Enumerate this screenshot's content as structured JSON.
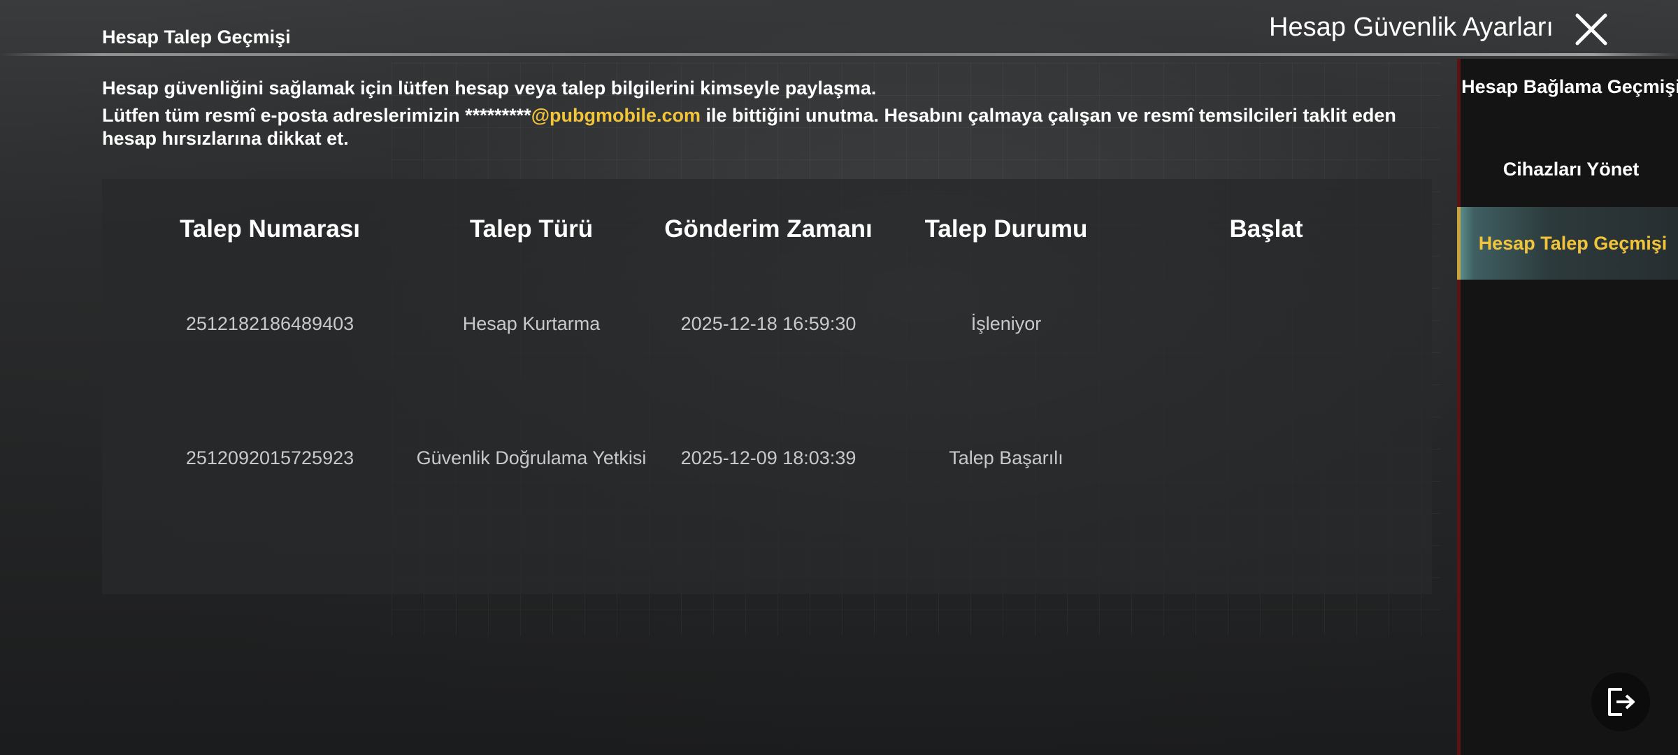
{
  "header": {
    "page_title": "Hesap Talep Geçmişi",
    "window_title": "Hesap Güvenlik Ayarları"
  },
  "notice": {
    "line1": "Hesap güvenliğini sağlamak için lütfen hesap veya talep bilgilerini kimseyle paylaşma.",
    "line2_before": "Lütfen tüm resmî e-posta adreslerimizin *********",
    "line2_email": "@pubgmobile.com",
    "line2_after": " ile bittiğini unutma. Hesabını çalmaya çalışan ve resmî temsilcileri taklit eden hesap hırsızlarına dikkat et."
  },
  "table": {
    "columns": [
      "Talep Numarası",
      "Talep Türü",
      "Gönderim Zamanı",
      "Talep Durumu",
      "Başlat"
    ],
    "rows": [
      {
        "id": "2512182186489403",
        "type": "Hesap Kurtarma",
        "time": "2025-12-18 16:59:30",
        "status": "İşleniyor",
        "action": ""
      },
      {
        "id": "2512092015725923",
        "type": "Güvenlik Doğrulama Yetkisi",
        "time": "2025-12-09 18:03:39",
        "status": "Talep Başarılı",
        "action": ""
      }
    ]
  },
  "sidebar": {
    "items": [
      {
        "label": "Hesap Bağlama Geçmişi",
        "active": false
      },
      {
        "label": "Cihazları Yönet",
        "active": false
      },
      {
        "label": "Hesap Talep Geçmişi",
        "active": true
      }
    ]
  },
  "colors": {
    "accent": "#f2c43a",
    "panel": "#28292a",
    "sidebar": "#141414"
  },
  "icons": {
    "close": "close-icon",
    "logout": "logout-icon"
  }
}
